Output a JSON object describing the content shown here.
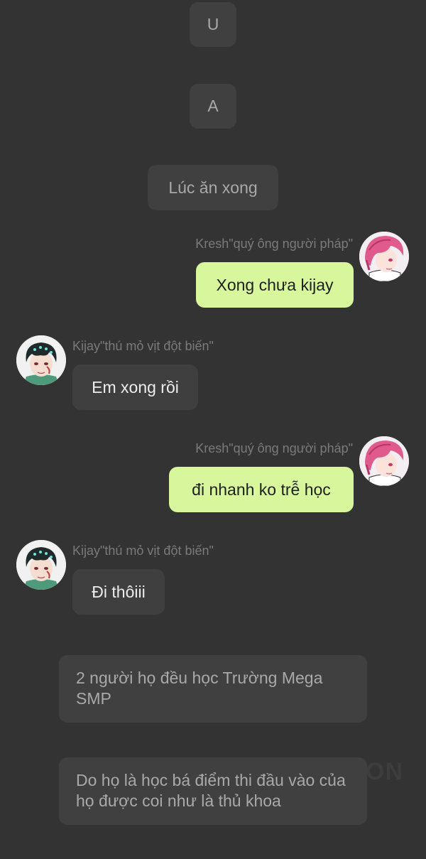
{
  "narration": [
    {
      "text": "U"
    },
    {
      "text": "A"
    },
    {
      "text": "Lúc ăn xong"
    },
    {
      "text": "2 người họ đều học Trường Mega SMP"
    },
    {
      "text": "Do họ là học bá điểm thi đầu vào của họ được coi như là thủ khoa"
    }
  ],
  "messages": [
    {
      "sender": "Kresh\"quý ông người pháp\"",
      "side": "right",
      "text": "Xong chưa kijay",
      "avatar_icon": "pink-hair-avatar-icon"
    },
    {
      "sender": "Kijay\"thú mỏ vịt đột biến\"",
      "side": "left",
      "text": "Em xong rồi",
      "avatar_icon": "dark-hair-avatar-icon"
    },
    {
      "sender": "Kresh\"quý ông người pháp\"",
      "side": "right",
      "text": "đi nhanh ko trễ học",
      "avatar_icon": "pink-hair-avatar-icon"
    },
    {
      "sender": "Kijay\"thú mỏ vịt đột biến\"",
      "side": "left",
      "text": "Đi thôiii",
      "avatar_icon": "dark-hair-avatar-icon"
    }
  ],
  "colors": {
    "background": "#333333",
    "narration_bubble": "#404040",
    "my_bubble": "#d8f69c",
    "other_bubble": "#3f3f3f",
    "sender_name": "#7a7a7a"
  },
  "watermark": "ON"
}
